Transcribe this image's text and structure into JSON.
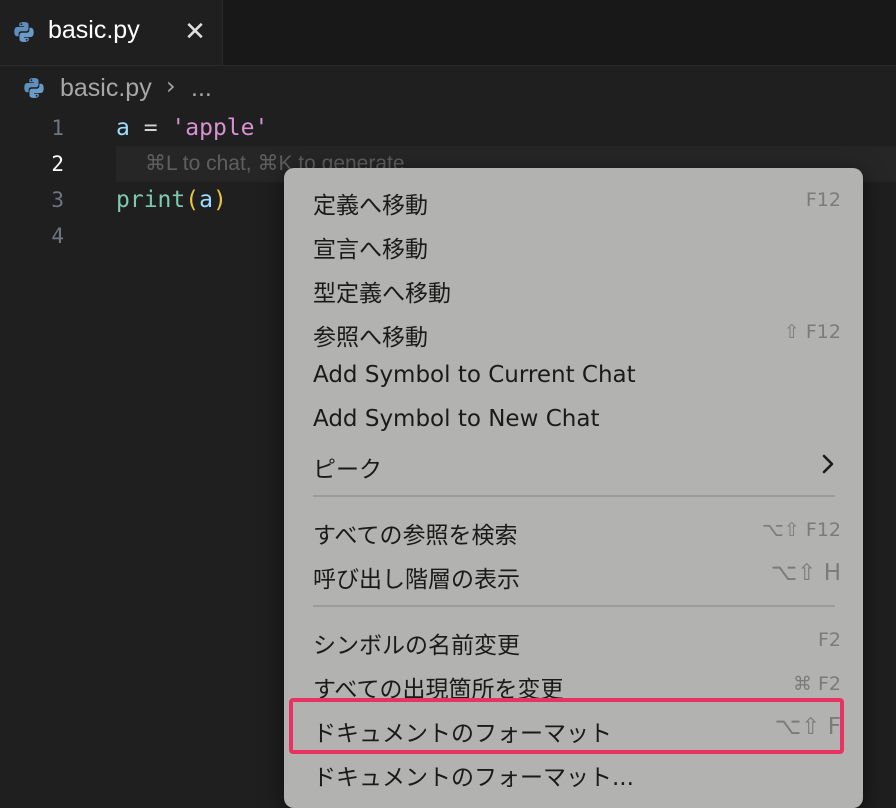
{
  "tab": {
    "label": "basic.py",
    "close": "✕"
  },
  "breadcrumb": {
    "file": "basic.py",
    "sep": "›",
    "more": "..."
  },
  "editor": {
    "line_numbers": [
      "1",
      "2",
      "3",
      "4"
    ],
    "line1": {
      "var": "a",
      "op": " = ",
      "str": "'apple'"
    },
    "line2_hint": "⌘L to chat, ⌘K to generate",
    "line3": {
      "fn": "print",
      "open": "(",
      "arg": "a",
      "close": ")"
    }
  },
  "menu": {
    "items": [
      {
        "label": "定義へ移動",
        "shortcut": "F12"
      },
      {
        "label": "宣言へ移動",
        "shortcut": ""
      },
      {
        "label": "型定義へ移動",
        "shortcut": ""
      },
      {
        "label": "参照へ移動",
        "shortcut": "⇧ F12"
      },
      {
        "label": "Add Symbol to Current Chat",
        "shortcut": ""
      },
      {
        "label": "Add Symbol to New Chat",
        "shortcut": ""
      },
      {
        "label": "ピーク",
        "shortcut": ""
      },
      {
        "label": "すべての参照を検索",
        "shortcut": "⌥⇧ F12"
      },
      {
        "label": "呼び出し階層の表示",
        "shortcut": "⌥⇧ H"
      },
      {
        "label": "シンボルの名前変更",
        "shortcut": "F2"
      },
      {
        "label": "すべての出現箇所を変更",
        "shortcut": "⌘ F2"
      },
      {
        "label": "ドキュメントのフォーマット",
        "shortcut": "⌥⇧ F"
      },
      {
        "label": "ドキュメントのフォーマット...",
        "shortcut": ""
      }
    ]
  },
  "colors": {
    "editor_bg": "#1f1f1f",
    "menu_bg": "#b2b2b0",
    "highlight": "#e8325f",
    "string": "#d991d1",
    "variable": "#9cdcfe",
    "function": "#7ec9b0"
  }
}
